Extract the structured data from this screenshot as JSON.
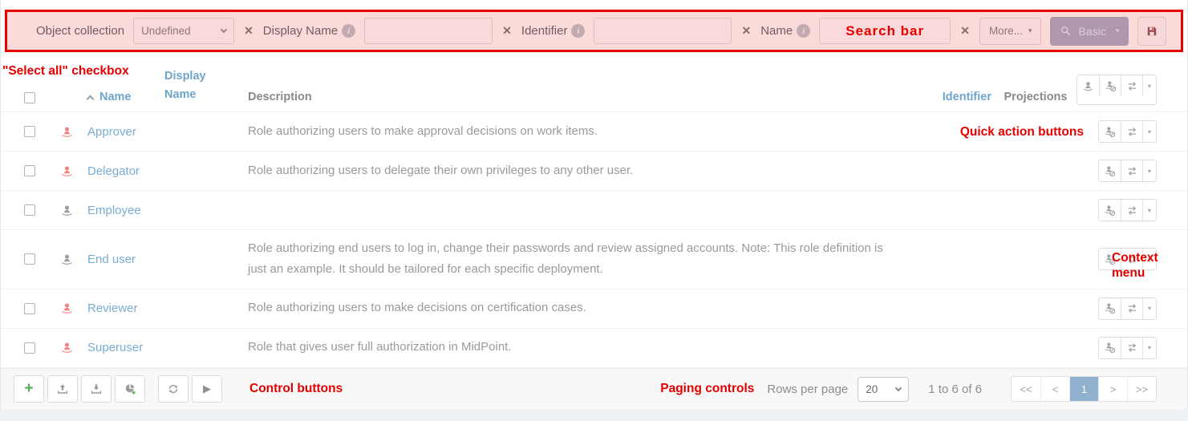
{
  "annotations": {
    "search_bar": "Search bar",
    "select_all": "\"Select all\" checkbox",
    "quick_actions": "Quick action buttons",
    "context_menu": "Context menu",
    "control_buttons": "Control buttons",
    "paging_controls": "Paging controls"
  },
  "search_bar": {
    "object_collection_label": "Object collection",
    "object_collection_value": "Undefined",
    "display_name_label": "Display Name",
    "identifier_label": "Identifier",
    "name_label": "Name",
    "more_label": "More...",
    "basic_label": "Basic"
  },
  "table": {
    "headers": {
      "name": "Name",
      "display_name": "Display Name",
      "description": "Description",
      "identifier": "Identifier",
      "projections": "Projections"
    },
    "rows": [
      {
        "name": "Approver",
        "icon_color": "red",
        "description": "Role authorizing users to make approval decisions on work items."
      },
      {
        "name": "Delegator",
        "icon_color": "red",
        "description": "Role authorizing users to delegate their own privileges to any other user."
      },
      {
        "name": "Employee",
        "icon_color": "gray",
        "description": ""
      },
      {
        "name": "End user",
        "icon_color": "gray",
        "description": "Role authorizing end users to log in, change their passwords and review assigned accounts. Note: This role definition is just an example. It should be tailored for each specific deployment."
      },
      {
        "name": "Reviewer",
        "icon_color": "red",
        "description": "Role authorizing users to make decisions on certification cases."
      },
      {
        "name": "Superuser",
        "icon_color": "red",
        "description": "Role that gives user full authorization in MidPoint."
      }
    ]
  },
  "footer": {
    "rows_per_page_label": "Rows per page",
    "rows_per_page_value": "20",
    "range_label": "1 to 6 of 6",
    "pagination": {
      "first": "<<",
      "prev": "<",
      "page": "1",
      "next": ">",
      "last": ">>"
    }
  },
  "icons": {
    "clear": "✕",
    "caret": "▾",
    "plus": "+",
    "play": "▶",
    "info": "i"
  },
  "colors": {
    "annotation_red": "#e60000",
    "link_blue": "#79add2",
    "header_blue": "#6fa5cb",
    "role_red": "#f2837f",
    "icon_gray": "#9e9e9e",
    "active_page_bg": "#90b1ce",
    "basic_button_tinted": "#b197ae",
    "search_overlay_pink": "#fbdbda"
  }
}
